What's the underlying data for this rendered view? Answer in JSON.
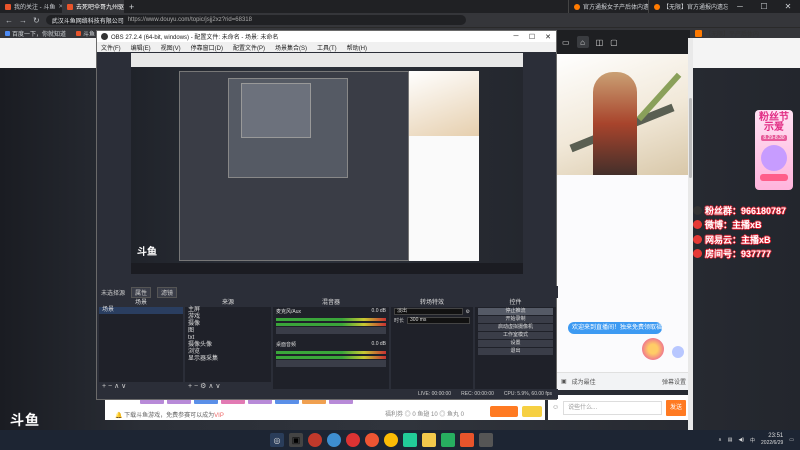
{
  "browser": {
    "tabs": [
      {
        "label": "我的关注 - 斗鱼",
        "active": false
      },
      {
        "label": "去死吧伞哥九州驱动",
        "active": true
      }
    ],
    "right_tabs": [
      {
        "label": "官方通报女子产后体内遗忘"
      },
      {
        "label": "【无限】官方通报内遗忘"
      }
    ],
    "url_prefix": "武汉斗鱼网络科技有限公司",
    "url": "https://www.douyu.com/topic/jsjj2xz?rid=68318",
    "bookmarks": [
      "百度一下，你就知道",
      "斗鱼 - 每个人的直播平台"
    ],
    "right_ad_label": "【无限】平产后体内"
  },
  "obs": {
    "title": "OBS 27.2.4 (64-bit, windows) - 配置文件: 未命名 - 场景: 未命名",
    "menu": [
      "文件(F)",
      "编辑(E)",
      "视图(V)",
      "停靠窗口(D)",
      "配置文件(P)",
      "场景集合(S)",
      "工具(T)",
      "帮助(H)"
    ],
    "strip_label": "未选择源",
    "strip_buttons": [
      "属性",
      "滤镜"
    ],
    "panels": {
      "scenes": {
        "header": "场景",
        "items": [
          "场景"
        ]
      },
      "sources": {
        "header": "来源",
        "items": [
          "主屏",
          "游戏",
          "摄像",
          "图",
          "txt",
          "摄像头像",
          "浏览",
          "显示器采集"
        ]
      },
      "mixer": {
        "header": "混音器",
        "tracks": [
          {
            "name": "麦克风/Aux",
            "db": "0.0 dB"
          },
          {
            "name": "桌面音频",
            "db": "0.0 dB"
          }
        ]
      },
      "transitions": {
        "header": "转场特效",
        "type": "淡出",
        "duration_label": "时长",
        "duration": "300 ms"
      },
      "controls": {
        "header": "控件",
        "buttons": [
          "停止推流",
          "开始录制",
          "启动虚拟摄像机",
          "工作室模式",
          "设置",
          "退出"
        ]
      }
    },
    "status": [
      "LIVE: 00:00:00",
      "REC: 00:00:00",
      "CPU: 5.9%, 60.00 fps"
    ]
  },
  "stream": {
    "chat_message": "欢迎来到直播间！独来免费领取福利！",
    "chat_footer_left": "成为最佳",
    "chat_footer_right": "弹幕设置",
    "input_placeholder": "说些什么...",
    "send_label": "发送",
    "tip_prefix": "下载斗鱼游戏，免费参赛可以成为",
    "tip_highlight": "VIP",
    "mid_text": "福利券 ◎ 0   鱼翅 10   ◎ 鱼丸 0",
    "side_banner_title": "粉丝节\n示爱",
    "side_banner_date": "8.29-8.30"
  },
  "socials": [
    {
      "label": "粉丝群：966180787",
      "icon": "penguin-icon"
    },
    {
      "label": "微博：主播xB",
      "icon": "weibo-icon"
    },
    {
      "label": "网易云：主播xB",
      "icon": "netease-icon"
    },
    {
      "label": "房间号：937777",
      "icon": "home-icon"
    }
  ],
  "taskbar": {
    "time": "23:51",
    "date": "2022/6/29"
  },
  "logo": "斗鱼"
}
